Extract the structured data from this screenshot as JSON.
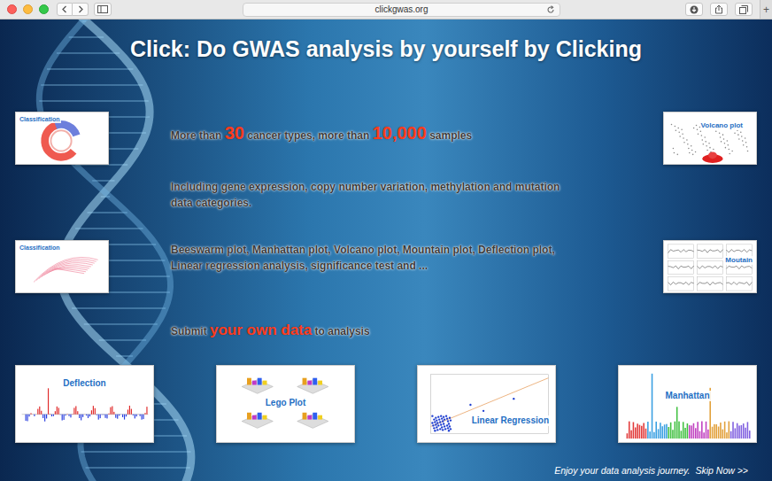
{
  "browser": {
    "url": "clickgwas.org",
    "new_tab": "+"
  },
  "page": {
    "title": "Click: Do GWAS analysis by yourself by Clicking",
    "features": [
      {
        "lines": [
          [
            {
              "text": "More than ",
              "highlight": false
            },
            {
              "text": "30",
              "highlight": true
            },
            {
              "text": " cancer types, more than ",
              "highlight": false
            },
            {
              "text": "10,000",
              "highlight": true
            },
            {
              "text": " samples",
              "highlight": false
            }
          ]
        ]
      },
      {
        "lines": [
          [
            {
              "text": "Including gene expression, copy number variation, methylation and mutation",
              "highlight": false
            }
          ],
          [
            {
              "text": "data categories.",
              "highlight": false
            }
          ]
        ]
      },
      {
        "lines": [
          [
            {
              "text": "Beeswarm plot, Manhattan plot, Volcano plot, Mountain plot, Deflection plot,",
              "highlight": false
            }
          ],
          [
            {
              "text": "Linear regression analysis, significance test and ...",
              "highlight": false
            }
          ]
        ]
      },
      {
        "lines": [
          [
            {
              "text": "Submit ",
              "highlight": false
            },
            {
              "text": "your own data",
              "highlight": true
            },
            {
              "text": " to analysis",
              "highlight": false
            }
          ]
        ]
      }
    ],
    "side_left": [
      {
        "label": "Classification",
        "kind": "circos"
      },
      {
        "label": "Classification",
        "kind": "network"
      }
    ],
    "side_right": [
      {
        "label": "Volcano plot",
        "kind": "volcano"
      },
      {
        "label": "Moutain",
        "kind": "mountain"
      }
    ],
    "bottom": [
      {
        "label": "Deflection",
        "kind": "deflection"
      },
      {
        "label": "Lego Plot",
        "kind": "lego"
      },
      {
        "label": "Linear Regression",
        "kind": "regression"
      },
      {
        "label": "Manhattan",
        "kind": "manhattan"
      }
    ],
    "footer": {
      "message": "Enjoy your data analysis journey.",
      "link": "Skip Now >>"
    }
  }
}
